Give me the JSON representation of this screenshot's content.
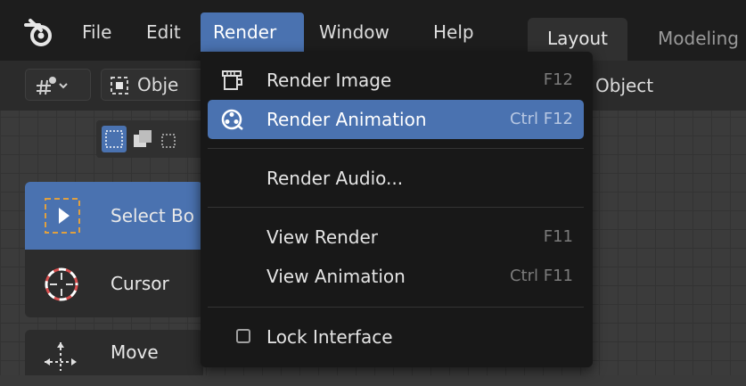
{
  "menubar": {
    "items": [
      "File",
      "Edit",
      "Render",
      "Window",
      "Help"
    ],
    "active": "Render"
  },
  "workspace_tabs": [
    "Layout",
    "Modeling"
  ],
  "header": {
    "object_mode_label": "Obje",
    "right_label": "Object"
  },
  "toolbar": {
    "tools": [
      {
        "label": "Select Bo",
        "icon": "select-box-icon",
        "active": true
      },
      {
        "label": "Cursor",
        "icon": "cursor-icon",
        "active": false
      },
      {
        "label": "Move",
        "icon": "move-icon",
        "active": false
      }
    ]
  },
  "render_menu": {
    "items": [
      {
        "label": "Render Image",
        "shortcut": "F12",
        "icon": "render-image-icon"
      },
      {
        "label": "Render Animation",
        "shortcut": "Ctrl F12",
        "icon": "render-animation-icon",
        "highlighted": true
      },
      {
        "label": "Render Audio...",
        "shortcut": ""
      },
      {
        "label": "View Render",
        "shortcut": "F11"
      },
      {
        "label": "View Animation",
        "shortcut": "Ctrl F11"
      },
      {
        "label": "Lock Interface",
        "shortcut": "",
        "checkbox": false
      }
    ]
  },
  "colors": {
    "accent": "#4a72b0",
    "menu_bg": "#181818",
    "topbar_bg": "#1d1d1d"
  }
}
